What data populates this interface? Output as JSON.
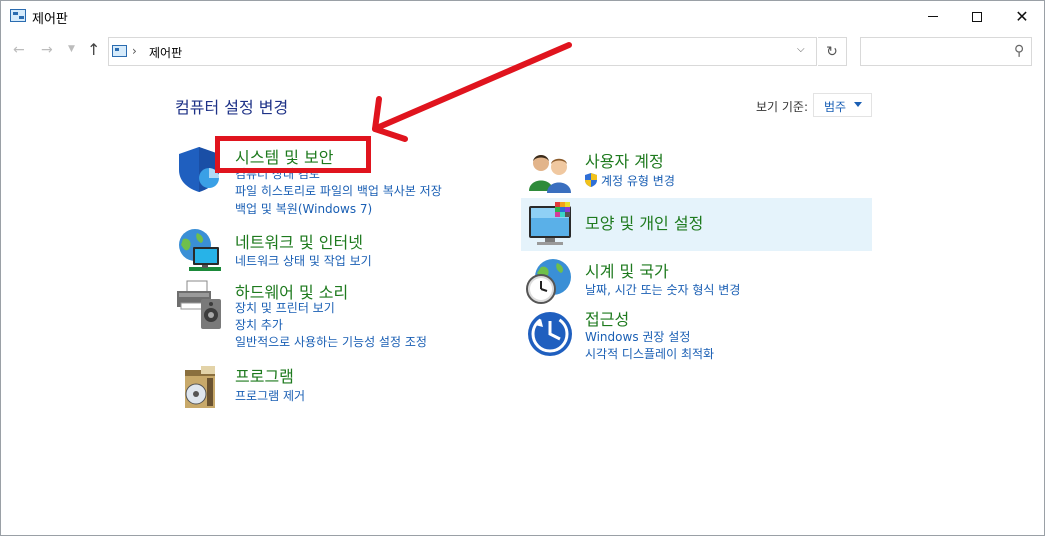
{
  "window": {
    "title": "제어판"
  },
  "nav": {
    "breadcrumb_sep": "›",
    "breadcrumb": "제어판",
    "search_placeholder": ""
  },
  "main": {
    "heading": "컴퓨터 설정 변경",
    "view_by_label": "보기 기준:",
    "view_by_value": "범주"
  },
  "categories": [
    {
      "title": "시스템 및 보안",
      "links": [
        "컴퓨터 상태 검토",
        "파일 히스토리로 파일의 백업 복사본 저장",
        "백업 및 복원(Windows 7)"
      ],
      "icon": "shield-icon"
    },
    {
      "title": "네트워크 및 인터넷",
      "links": [
        "네트워크 상태 및 작업 보기"
      ],
      "icon": "network-icon"
    },
    {
      "title": "하드웨어 및 소리",
      "links": [
        "장치 및 프린터 보기",
        "장치 추가",
        "일반적으로 사용하는 기능성 설정 조정"
      ],
      "icon": "printer-icon"
    },
    {
      "title": "프로그램",
      "links": [
        "프로그램 제거"
      ],
      "icon": "programs-icon"
    },
    {
      "title": "사용자 계정",
      "links": [
        "계정 유형 변경"
      ],
      "icon": "users-icon"
    },
    {
      "title": "모양 및 개인 설정",
      "links": [],
      "icon": "monitor-icon"
    },
    {
      "title": "시계 및 국가",
      "links": [
        "날짜, 시간 또는 숫자 형식 변경"
      ],
      "icon": "clock-globe-icon"
    },
    {
      "title": "접근성",
      "links": [
        "Windows 권장 설정",
        "시각적 디스플레이 최적화"
      ],
      "icon": "accessibility-icon"
    }
  ],
  "colors": {
    "title_green": "#1e7a1e",
    "link_blue": "#1a5fb4",
    "heading_blue": "#1e3287",
    "annotation_red": "#e0141e",
    "hover_bg": "#e5f3fb"
  }
}
